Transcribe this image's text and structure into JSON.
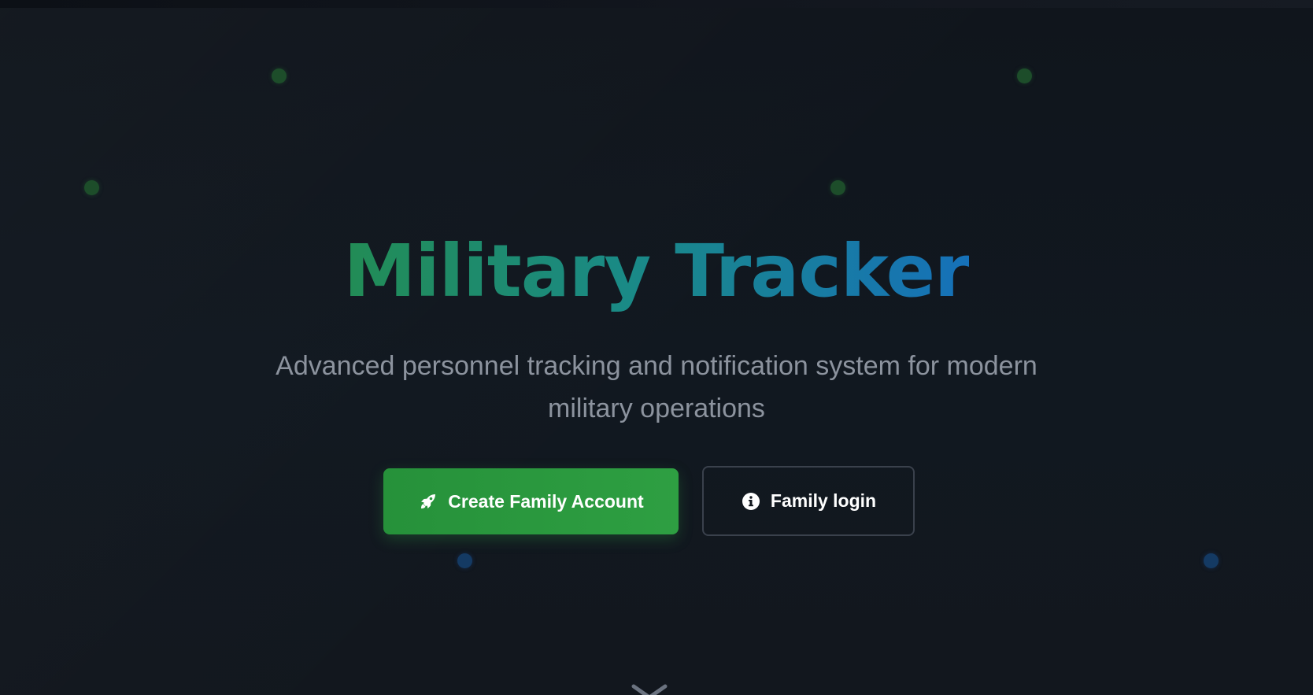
{
  "hero": {
    "title": "Military Tracker",
    "subtitle": "Advanced personnel tracking and notification system for modern military operations"
  },
  "actions": {
    "create_account_label": "Create Family Account",
    "create_account_icon": "rocket-icon",
    "login_label": "Family login",
    "login_icon": "info-circle-icon"
  },
  "scroll_indicator_icon": "chevron-down-icon",
  "colors": {
    "background": "#10151c",
    "title_gradient_start": "#228c55",
    "title_gradient_end": "#1671b9",
    "primary_button": "#2ea043",
    "subtitle": "#8c939e",
    "accent_dot_green": "#1d4d2a",
    "accent_dot_blue": "#143a63"
  }
}
